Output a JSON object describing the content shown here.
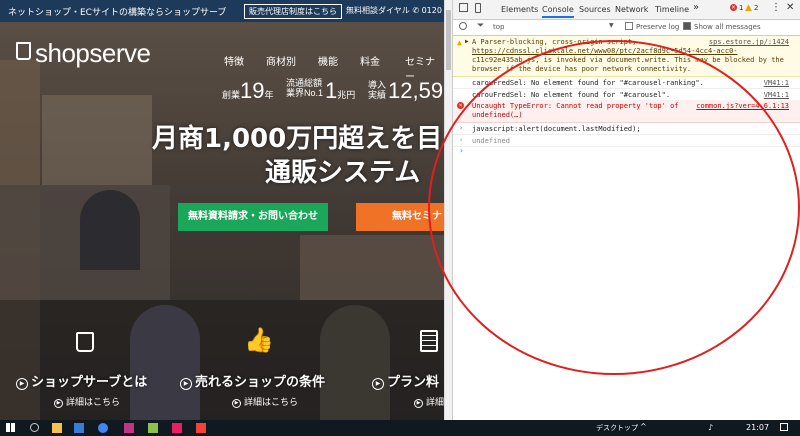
{
  "site": {
    "topbar": {
      "tagline": "ネットショップ・ECサイトの構築ならショップサーブ",
      "agency_button": "販売代理店制度はこちら",
      "free_consult": "無料相談ダイヤル",
      "phone_fragment": "0120"
    },
    "logo": "shopserve",
    "nav": [
      "特徴",
      "商材別",
      "機能",
      "料金",
      "セミナー"
    ],
    "stats": {
      "founded_label": "創業",
      "years_value": "19",
      "years_unit": "年",
      "rank_label_1": "流通総額",
      "rank_label_2": "業界No.1",
      "rank_value": "1",
      "rank_unit": "兆円",
      "adoption_label_1": "導入",
      "adoption_label_2": "実績",
      "adoption_value": "12,59"
    },
    "headline": {
      "line1": "月商1,000万円超えを目",
      "line2": "通販システム"
    },
    "buttons": {
      "request": "無料資料請求・お問い合わせ",
      "seminar": "無料セミナ"
    },
    "features": [
      {
        "title": "ショップサーブとは",
        "detail": "詳細はこちら"
      },
      {
        "title": "売れるショップの条件",
        "detail": "詳細はこちら"
      },
      {
        "title": "プラン料",
        "detail": "詳細はこちら"
      }
    ]
  },
  "devtools": {
    "tabs": [
      "Elements",
      "Console",
      "Sources",
      "Network",
      "Timeline"
    ],
    "more_tabs": "»",
    "error_count": "1",
    "warning_count": "2",
    "context": "top",
    "preserve_log": "Preserve log",
    "show_all": "Show all messages",
    "messages": {
      "warning_text_1": "A Parser-blocking, cross-origin script,",
      "warning_text_2": "https://cdnssl.clicktale.net/www08/ptc/2acf8d9c-5d54-4cc4-acc0-",
      "warning_text_3": "c11c92e435ab.js, is invoked via document.write. This may be blocked by the",
      "warning_text_4": "browser if the device has poor network connectivity.",
      "warning_source": "sps.estore.jp/:1424",
      "log1_text": "carouFredSel: No element found for \"#carousel-ranking\".",
      "log1_source": "VM41:1",
      "log2_text": "carouFredSel: No element found for \"#carousel\".",
      "log2_source": "VM41:1",
      "error_text_1": "Uncaught TypeError: Cannot read property 'top' of",
      "error_text_2": "undefined(…)",
      "error_source": "common.js?ver=4.6.1:13",
      "input_text": "javascript:alert(document.lastModified);",
      "result_text": "undefined"
    }
  },
  "taskbar": {
    "desktop_label": "デスクトップ",
    "clock": "21:07"
  },
  "colors": {
    "topbar": "#1d3a5a",
    "green_button": "#1ba75a",
    "orange_button": "#f07226",
    "annotation_circle": "#e01f1f",
    "console_error": "#c80000"
  }
}
